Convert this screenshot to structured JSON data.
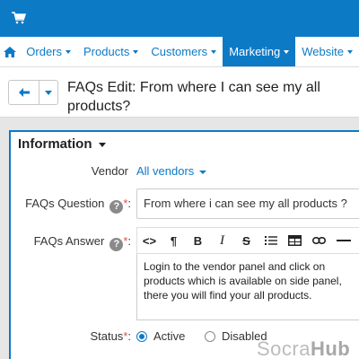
{
  "nav": {
    "items": [
      {
        "label": "Orders"
      },
      {
        "label": "Products"
      },
      {
        "label": "Customers"
      },
      {
        "label": "Marketing"
      },
      {
        "label": "Website"
      }
    ],
    "active": "Marketing"
  },
  "page": {
    "title": "FAQs Edit: From where I can see my all products?"
  },
  "section": {
    "title": "Information"
  },
  "form": {
    "vendor_label": "Vendor",
    "vendor_value": "All vendors",
    "question_label": "FAQs Question",
    "question_value": "From where i can see my all products ?",
    "answer_label": "FAQs Answer",
    "answer_value": "Login to the vendor panel and click on products which is available on side panel, there you will find your all products.",
    "status_label": "Status",
    "status_options": [
      "Active",
      "Disabled"
    ],
    "status_selected": "Active",
    "required_mark": "*",
    "help_mark": "?"
  },
  "editor_toolbar": [
    "<>",
    "¶",
    "B",
    "I",
    "S",
    "bullet-list-icon",
    "table-icon",
    "link-icon",
    "horizontal-rule-icon"
  ],
  "watermark": {
    "part1": "Socra",
    "part2": "Hub"
  },
  "colors": {
    "accent": "#0d7ac6",
    "required": "#d9534f"
  }
}
